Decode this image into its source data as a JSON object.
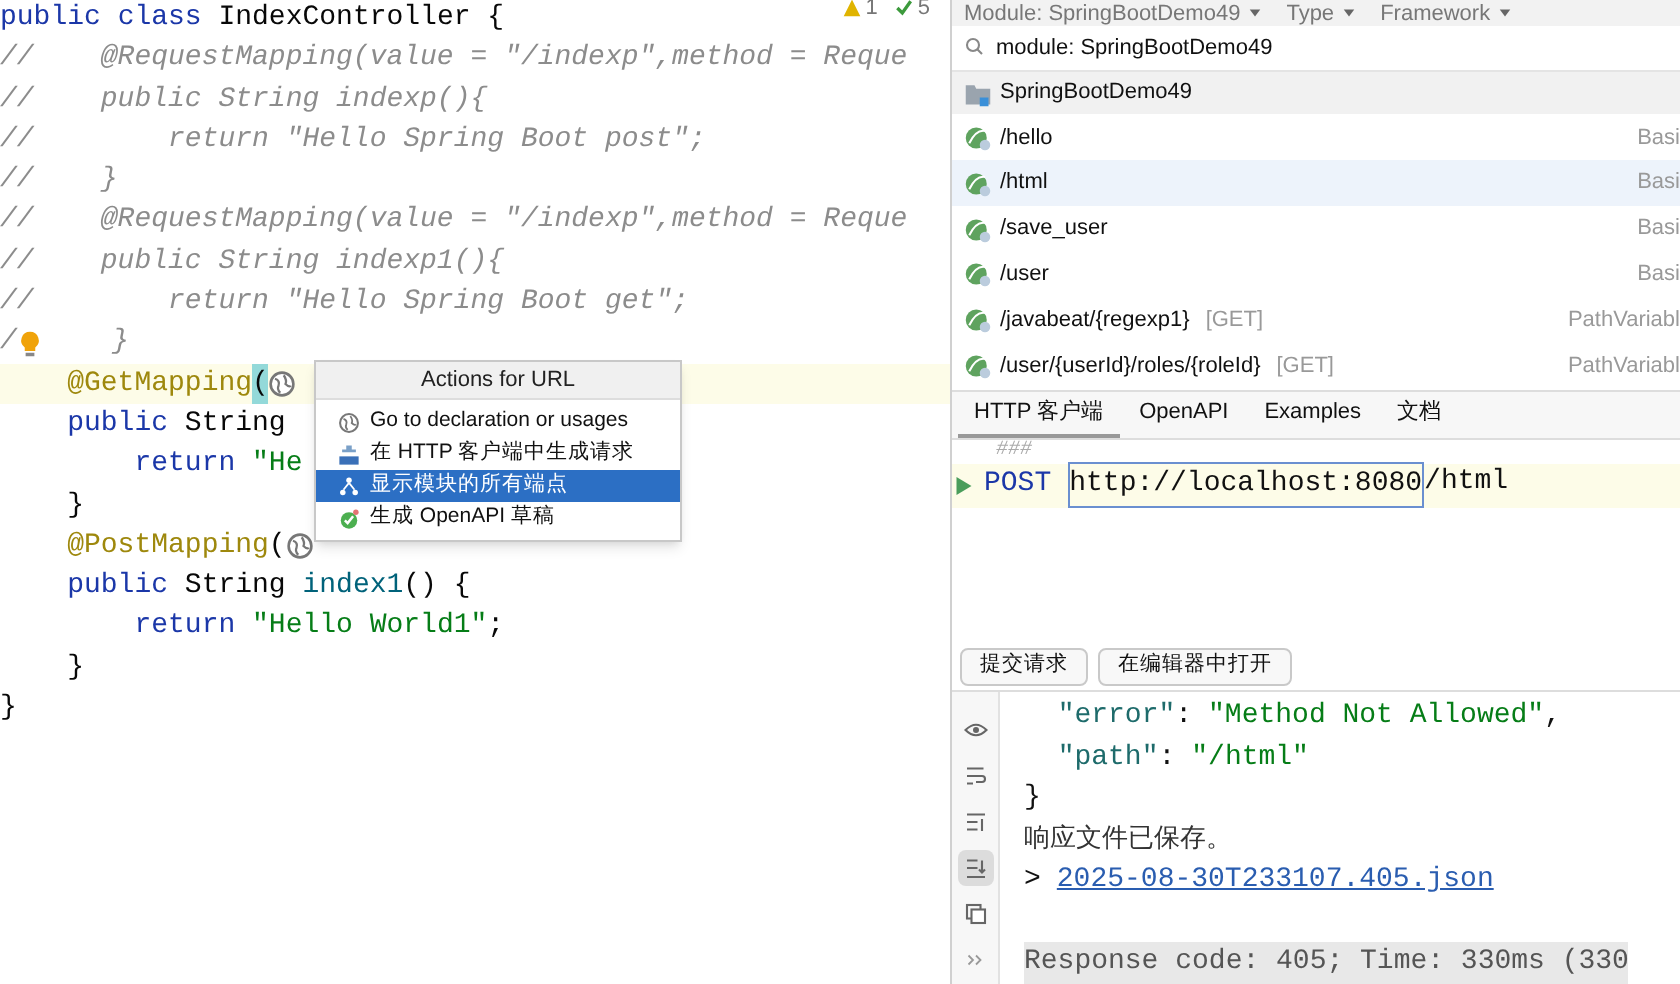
{
  "editor": {
    "inspections": [
      {
        "kind": "warning",
        "count": "1"
      },
      {
        "kind": "ok",
        "count": "5"
      }
    ],
    "lines": [
      {
        "segments": [
          {
            "kind": "kw",
            "s": "public "
          },
          {
            "kind": "kw",
            "s": "class"
          },
          {
            "kind": "txt",
            "s": " IndexController {"
          }
        ]
      },
      {
        "segments": [
          {
            "kind": "cmt",
            "s": "//    @RequestMapping(value = \"/indexp\",method = Reque"
          }
        ]
      },
      {
        "segments": [
          {
            "kind": "cmt",
            "s": "//    public String indexp(){"
          }
        ]
      },
      {
        "segments": [
          {
            "kind": "cmt",
            "s": "//        return \"Hello Spring Boot post\";"
          }
        ]
      },
      {
        "segments": [
          {
            "kind": "cmt",
            "s": "//    }"
          }
        ]
      },
      {
        "segments": [
          {
            "kind": "cmt",
            "s": "//    @RequestMapping(value = \"/indexp\",method = Reque"
          }
        ]
      },
      {
        "segments": [
          {
            "kind": "cmt",
            "s": "//    public String indexp1(){"
          }
        ]
      },
      {
        "segments": [
          {
            "kind": "cmt",
            "s": "//        return \"Hello Spring Boot get\";"
          }
        ]
      },
      {
        "segments": [
          {
            "kind": "cmt",
            "s": "/"
          },
          {
            "kind": "bulb"
          },
          {
            "kind": "cmt",
            "s": "    }"
          }
        ]
      },
      {
        "current": true,
        "segments": [
          {
            "kind": "ann",
            "s": "    @GetMapping"
          },
          {
            "kind": "match",
            "s": "("
          },
          {
            "kind": "globe"
          }
        ]
      },
      {
        "current": false,
        "segments": [
          {
            "kind": "kw",
            "s": "    public"
          },
          {
            "kind": "txt",
            "s": " String"
          }
        ]
      },
      {
        "current": false,
        "segments": [
          {
            "kind": "kw",
            "s": "        return "
          },
          {
            "kind": "str",
            "s": "\"He"
          }
        ]
      },
      {
        "current": false,
        "segments": [
          {
            "kind": "txt",
            "s": "    }"
          }
        ]
      },
      {
        "current": false,
        "segments": [
          {
            "kind": "ann",
            "s": "    @PostMapping"
          },
          {
            "kind": "txt",
            "s": "("
          },
          {
            "kind": "globe"
          }
        ]
      },
      {
        "current": false,
        "segments": [
          {
            "kind": "kw",
            "s": "    public"
          },
          {
            "kind": "txt",
            "s": " String "
          },
          {
            "kind": "fn",
            "s": "index1"
          },
          {
            "kind": "txt",
            "s": "() {"
          }
        ]
      },
      {
        "current": false,
        "segments": [
          {
            "kind": "kw",
            "s": "        return "
          },
          {
            "kind": "str",
            "s": "\"Hello World1\""
          },
          {
            "kind": "txt",
            "s": ";"
          }
        ]
      },
      {
        "current": false,
        "segments": [
          {
            "kind": "txt",
            "s": "    }"
          }
        ]
      },
      {
        "current": false,
        "segments": [
          {
            "kind": "txt",
            "s": "}"
          }
        ]
      }
    ],
    "popup": {
      "title": "Actions for URL",
      "items": [
        {
          "label": "Go to declaration or usages",
          "selected": false
        },
        {
          "label": "在 HTTP 客户端中生成请求",
          "selected": false
        },
        {
          "label": "显示模块的所有端点",
          "selected": true
        },
        {
          "label": "生成 OpenAPI 草稿",
          "selected": false
        }
      ]
    }
  },
  "endpoints": {
    "filters": [
      "Module: SpringBootDemo49",
      "Type",
      "Framework"
    ],
    "search": {
      "value": "module: SpringBootDemo49"
    },
    "group": "SpringBootDemo49",
    "rows": [
      {
        "path": "/hello",
        "type": "Basi",
        "selected": false
      },
      {
        "path": "/html",
        "type": "Basi",
        "selected": true
      },
      {
        "path": "/save_user",
        "type": "Basi",
        "selected": false
      },
      {
        "path": "/user",
        "type": "Basi",
        "selected": false
      },
      {
        "path": "/javabeat/{regexp1}",
        "method": "[GET]",
        "type": "PathVariabl",
        "selected": false
      },
      {
        "path": "/user/{userId}/roles/{roleId}",
        "method": "[GET]",
        "type": "PathVariabl",
        "selected": false
      }
    ]
  },
  "http_client": {
    "tabs": [
      {
        "label": "HTTP 客户端",
        "selected": true
      },
      {
        "label": "OpenAPI",
        "selected": false
      },
      {
        "label": "Examples",
        "selected": false
      },
      {
        "label": "文档",
        "selected": false
      }
    ],
    "comment": "###",
    "request": {
      "method": "POST",
      "host": "http://localhost:8080",
      "path": "/html"
    },
    "buttons": [
      "提交请求",
      "在编辑器中打开"
    ]
  },
  "response": {
    "tools": [
      {
        "kind": "eye",
        "selected": false
      },
      {
        "kind": "wrap",
        "selected": false
      },
      {
        "kind": "sort",
        "selected": false
      },
      {
        "kind": "scroll",
        "selected": true
      },
      {
        "kind": "copy",
        "selected": false
      },
      {
        "kind": "more",
        "selected": false
      }
    ],
    "lines": [
      {
        "kind": "pair",
        "key": "\"error\"",
        "colon": ":",
        "value": "\"Method Not Allowed\"",
        "end": ","
      },
      {
        "kind": "pair",
        "key": "\"path\"",
        "colon": ":",
        "value": "\"/html\""
      },
      {
        "kind": "brace",
        "text": "}"
      },
      {
        "kind": "note",
        "text": "响应文件已保存。"
      },
      {
        "kind": "link",
        "prefix": ">",
        "text": "2025-08-30T233107.405.json"
      },
      {
        "kind": "blank"
      },
      {
        "kind": "status",
        "text": "Response code: 405; Time: 330ms (330"
      }
    ]
  }
}
